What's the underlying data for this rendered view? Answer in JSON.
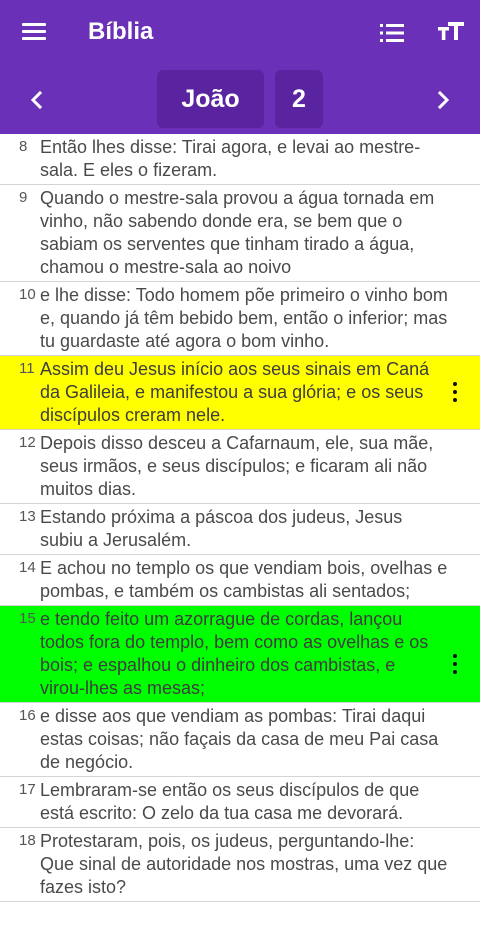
{
  "app": {
    "title": "Bíblia"
  },
  "icons": {
    "menu": "menu-icon",
    "list": "list-icon",
    "text_size": "text-size-icon",
    "prev": "chevron-left-icon",
    "next": "chevron-right-icon",
    "more": "more-vert-icon"
  },
  "colors": {
    "appbar": "#6a30b8",
    "selector_bg": "#5a24a0",
    "highlight_yellow": "#ffff00",
    "highlight_green": "#00ff00"
  },
  "navigation": {
    "book": "João",
    "chapter": "2"
  },
  "verses": [
    {
      "number": "8",
      "text": "Então lhes disse: Tirai agora, e levai ao mestre-sala. E eles o fizeram.",
      "highlight": ""
    },
    {
      "number": "9",
      "text": "Quando o mestre-sala provou a água tornada em vinho, não sabendo donde era, se bem que o sabiam os serventes que tinham tirado a água, chamou o mestre-sala ao noivo",
      "highlight": ""
    },
    {
      "number": "10",
      "text": "e lhe disse: Todo homem põe primeiro o vinho bom e, quando já têm bebido bem, então o inferior; mas tu guardaste até agora o bom vinho.",
      "highlight": ""
    },
    {
      "number": "11",
      "text": "Assim deu Jesus início aos seus sinais em Caná da Galileia, e manifestou a sua glória; e os seus discípulos creram nele.",
      "highlight": "yellow"
    },
    {
      "number": "12",
      "text": "Depois disso desceu a Cafarnaum, ele, sua mãe, seus irmãos, e seus discípulos; e ficaram ali não muitos dias.",
      "highlight": ""
    },
    {
      "number": "13",
      "text": "Estando próxima a páscoa dos judeus, Jesus subiu a Jerusalém.",
      "highlight": ""
    },
    {
      "number": "14",
      "text": "E achou no templo os que vendiam bois, ovelhas e pombas, e também os cambistas ali sentados;",
      "highlight": ""
    },
    {
      "number": "15",
      "text": "e tendo feito um azorrague de cordas, lançou todos fora do templo, bem como as ovelhas e os bois; e espalhou o dinheiro dos cambistas, e virou-lhes as mesas;",
      "highlight": "green"
    },
    {
      "number": "16",
      "text": "e disse aos que vendiam as pombas: Tirai daqui estas coisas; não façais da casa de meu Pai casa de negócio.",
      "highlight": ""
    },
    {
      "number": "17",
      "text": "Lembraram-se então os seus discípulos de que está escrito: O zelo da tua casa me devorará.",
      "highlight": ""
    },
    {
      "number": "18",
      "text": "Protestaram, pois, os judeus, perguntando-lhe: Que sinal de autoridade nos mostras, uma vez que fazes isto?",
      "highlight": ""
    }
  ]
}
